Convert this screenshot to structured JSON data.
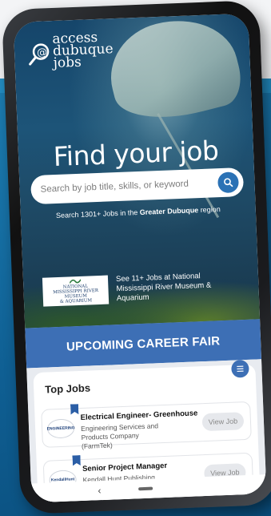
{
  "app": {
    "logo_line1": "access",
    "logo_line2": "dubuque",
    "logo_line3": "jobs"
  },
  "hero": {
    "headline": "Find your job",
    "search_placeholder": "Search by job title, skills, or keyword",
    "subline_prefix": "Search 1301+ Jobs in the ",
    "subline_bold": "Greater Dubuque",
    "subline_suffix": " region"
  },
  "museum": {
    "logo_line1": "NATIONAL",
    "logo_line2": "MISSISSIPPI RIVER MUSEUM",
    "logo_line3": "& AQUARIUM",
    "text": "See 11+ Jobs at National Mississippi River Museum & Aquarium"
  },
  "career_fair": {
    "label": "UPCOMING CAREER FAIR"
  },
  "top_jobs": {
    "title": "Top Jobs",
    "items": [
      {
        "title": "Electrical Engineer- Greenhouse",
        "company": "Engineering Services and Products Company (FarmTek)",
        "logo_text": "ENGINEERING",
        "button": "View Job"
      },
      {
        "title": "Senior Project Manager",
        "company": "Kendall Hunt Publishing Company",
        "logo_text": "KendallHunt",
        "button": "View Job"
      }
    ]
  },
  "navbar": {
    "back_glyph": "‹"
  },
  "colors": {
    "brand_blue": "#3d6fb5",
    "search_button": "#2b72b5"
  }
}
